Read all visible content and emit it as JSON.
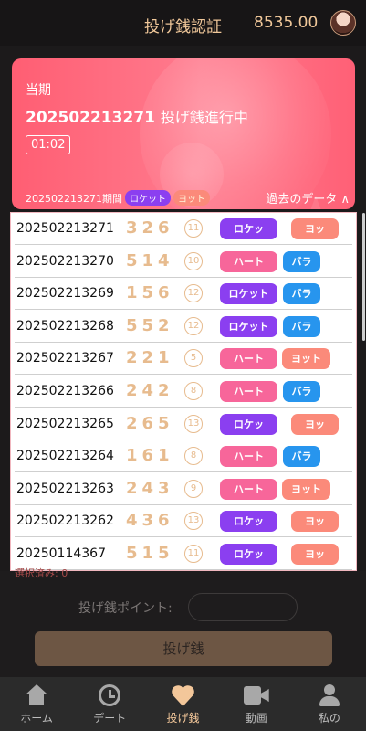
{
  "header": {
    "title": "投げ銭認証",
    "balance": "8535.00"
  },
  "hero": {
    "label": "当期",
    "period": "202502213271",
    "status": "投げ銭進行中",
    "timer": "01:02",
    "sub_period": "202502213271期間",
    "sub_tag1": "ロケット",
    "sub_tag2": "ヨット",
    "history": "過去のデータ ∧"
  },
  "results": [
    {
      "period": "202502213271",
      "numbers": "326",
      "sum": "11",
      "tag1": "ロケッ",
      "tag1_color": "purple",
      "tag2": "ヨッ",
      "tag2_color": "salmon"
    },
    {
      "period": "202502213270",
      "numbers": "514",
      "sum": "10",
      "tag1": "ハート",
      "tag1_color": "pink",
      "tag2": "バラ",
      "tag2_color": "blue"
    },
    {
      "period": "202502213269",
      "numbers": "156",
      "sum": "12",
      "tag1": "ロケット",
      "tag1_color": "purple",
      "tag2": "バラ",
      "tag2_color": "blue"
    },
    {
      "period": "202502213268",
      "numbers": "552",
      "sum": "12",
      "tag1": "ロケット",
      "tag1_color": "purple",
      "tag2": "バラ",
      "tag2_color": "blue"
    },
    {
      "period": "202502213267",
      "numbers": "221",
      "sum": "5",
      "tag1": "ハート",
      "tag1_color": "pink",
      "tag2": "ヨット",
      "tag2_color": "salmon"
    },
    {
      "period": "202502213266",
      "numbers": "242",
      "sum": "8",
      "tag1": "ハート",
      "tag1_color": "pink",
      "tag2": "バラ",
      "tag2_color": "blue"
    },
    {
      "period": "202502213265",
      "numbers": "265",
      "sum": "13",
      "tag1": "ロケッ",
      "tag1_color": "purple",
      "tag2": "ヨッ",
      "tag2_color": "salmon"
    },
    {
      "period": "202502213264",
      "numbers": "161",
      "sum": "8",
      "tag1": "ハート",
      "tag1_color": "pink",
      "tag2": "バラ",
      "tag2_color": "blue"
    },
    {
      "period": "202502213263",
      "numbers": "243",
      "sum": "9",
      "tag1": "ハート",
      "tag1_color": "pink",
      "tag2": "ヨット",
      "tag2_color": "salmon"
    },
    {
      "period": "202502213262",
      "numbers": "436",
      "sum": "13",
      "tag1": "ロケッ",
      "tag1_color": "purple",
      "tag2": "ヨッ",
      "tag2_color": "salmon"
    },
    {
      "period": "20250114367",
      "numbers": "515",
      "sum": "11",
      "tag1": "ロケッ",
      "tag1_color": "purple",
      "tag2": "ヨッ",
      "tag2_color": "salmon"
    }
  ],
  "bet": {
    "fragment": "選択済み: 0",
    "point_label": "投げ銭ポイント:",
    "point_value": "",
    "button": "投げ銭"
  },
  "nav": [
    {
      "label": "ホーム",
      "icon": "home-icon"
    },
    {
      "label": "デート",
      "icon": "clock-icon"
    },
    {
      "label": "投げ銭",
      "icon": "heart-icon",
      "active": true
    },
    {
      "label": "動画",
      "icon": "video-icon"
    },
    {
      "label": "私の",
      "icon": "user-icon"
    }
  ]
}
